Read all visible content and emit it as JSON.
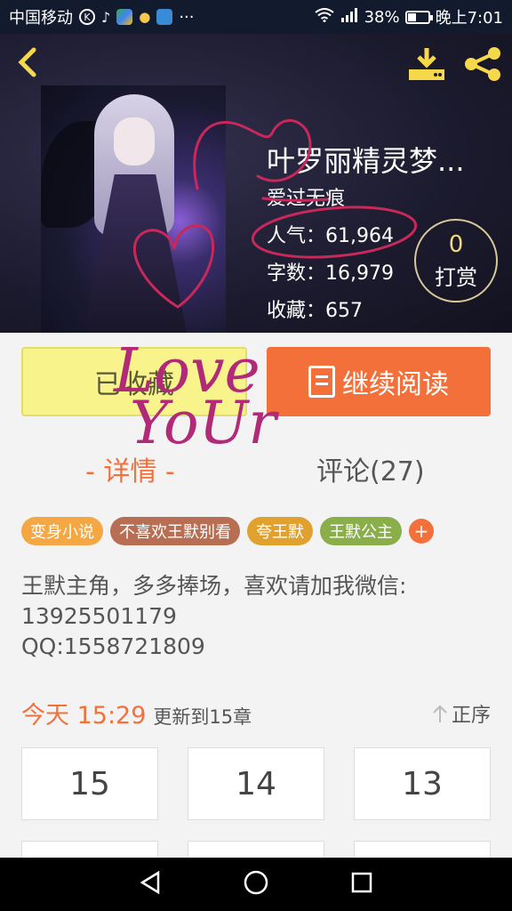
{
  "status_bar": {
    "carrier": "中国移动",
    "battery": "38%",
    "time": "晚上7:01"
  },
  "book": {
    "title": "叶罗丽精灵梦...",
    "author": "爱过无痕",
    "stats": [
      {
        "label": "人气：",
        "value": "61,964"
      },
      {
        "label": "字数：",
        "value": "16,979"
      },
      {
        "label": "收藏：",
        "value": "657"
      }
    ],
    "reward": {
      "count": "0",
      "label": "打赏"
    }
  },
  "actions": {
    "favorite": "已收藏",
    "read": "继续阅读"
  },
  "tabs": {
    "detail": "- 详情 -",
    "comments": "评论(27)"
  },
  "tags": [
    {
      "label": "变身小说",
      "color": "#f4a742"
    },
    {
      "label": "不喜欢王默别看",
      "color": "#b86e52"
    },
    {
      "label": "夸王默",
      "color": "#e0a12e"
    },
    {
      "label": "王默公主",
      "color": "#8aaf4a"
    }
  ],
  "description": "王默主角，多多捧场，喜欢请加我微信:\n13925501179\nQQ:1558721809",
  "update": {
    "time": "今天 15:29",
    "text": "更新到15章",
    "order": "正序"
  },
  "chapters": [
    "15",
    "14",
    "13"
  ],
  "handwriting": [
    "Love",
    "YoUr"
  ],
  "colors": {
    "accent": "#f3703a",
    "doodle": "#c8285a"
  }
}
